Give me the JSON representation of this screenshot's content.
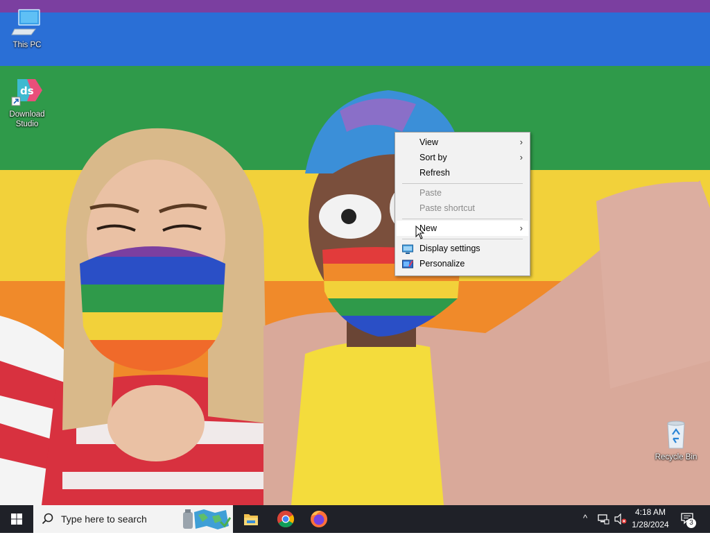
{
  "desktop": {
    "icons": [
      {
        "label": "This PC",
        "icon": "computer-icon"
      },
      {
        "label": "Download\nStudio",
        "icon": "download-studio-icon"
      },
      {
        "label": "Recycle Bin",
        "icon": "recycle-bin-icon"
      }
    ],
    "wallpaper": {
      "description_colors": [
        "#7b3fa0",
        "#2a6fd6",
        "#2f9a4a",
        "#f2d13a",
        "#f08a2a",
        "#e23b3b"
      ]
    }
  },
  "context_menu": {
    "items": [
      {
        "label": "View",
        "submenu": true,
        "enabled": true
      },
      {
        "label": "Sort by",
        "submenu": true,
        "enabled": true
      },
      {
        "label": "Refresh",
        "submenu": false,
        "enabled": true
      },
      {
        "label": "Paste",
        "submenu": false,
        "enabled": false
      },
      {
        "label": "Paste shortcut",
        "submenu": false,
        "enabled": false
      },
      {
        "label": "New",
        "submenu": true,
        "enabled": true,
        "highlighted": true
      },
      {
        "label": "Display settings",
        "submenu": false,
        "enabled": true,
        "icon": "display-icon"
      },
      {
        "label": "Personalize",
        "submenu": false,
        "enabled": true,
        "icon": "personalize-icon"
      }
    ],
    "arrow_glyph": "›"
  },
  "taskbar": {
    "search_placeholder": "Type here to search",
    "pinned_apps": [
      {
        "name": "File Explorer",
        "icon": "file-explorer-icon"
      },
      {
        "name": "Google Chrome",
        "icon": "chrome-icon"
      },
      {
        "name": "Firefox",
        "icon": "firefox-icon"
      }
    ],
    "tray": {
      "chevron": "^",
      "time": "4:18 AM",
      "date": "1/28/2024",
      "notification_count": "3"
    },
    "colors": {
      "background": "#1f2128",
      "search_bg": "#f3f3f3"
    }
  }
}
